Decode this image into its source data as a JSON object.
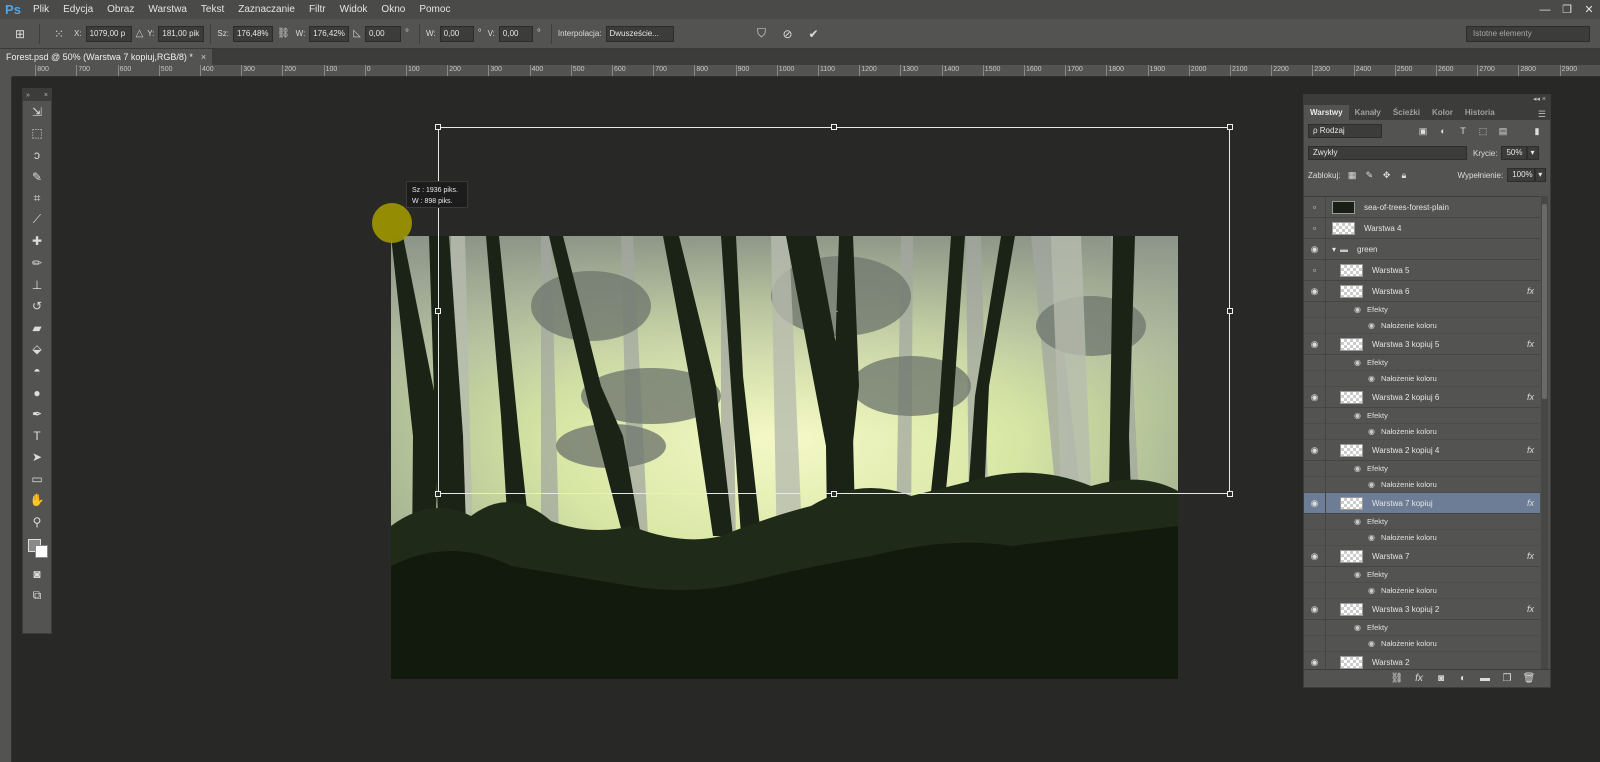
{
  "app": {
    "logo": "Ps"
  },
  "menu": [
    "Plik",
    "Edycja",
    "Obraz",
    "Warstwa",
    "Tekst",
    "Zaznaczanie",
    "Filtr",
    "Widok",
    "Okno",
    "Pomoc"
  ],
  "window_controls": {
    "minimize": "—",
    "maximize": "❐",
    "close": "✕"
  },
  "options": {
    "x_label": "X:",
    "x_value": "1079,00 p",
    "y_label": "Y:",
    "y_value": "181,00 pik",
    "w_label": "Sz:",
    "w_value": "176,48%",
    "h_label": "W:",
    "h_value": "176,42%",
    "angle_value": "0,00",
    "angle_unit": "°",
    "hskew_label": "W:",
    "hskew_value": "0,00",
    "hskew_unit": "°",
    "vskew_label": "V:",
    "vskew_value": "0,00",
    "vskew_unit": "°",
    "interp_label": "Interpolacja:",
    "interp_value": "Dwuszeście...",
    "workspace": "Istotne elementy"
  },
  "document_tab": {
    "title": "Forest.psd @ 50% (Warstwa 7 kopiuj,RGB/8) *",
    "close": "×"
  },
  "ruler_labels": [
    "900",
    "800",
    "700",
    "600",
    "500",
    "400",
    "300",
    "200",
    "100",
    "0",
    "100",
    "200",
    "300",
    "400",
    "500",
    "600",
    "700",
    "800",
    "900",
    "1000",
    "1100",
    "1200",
    "1300",
    "1400",
    "1500",
    "1600",
    "1700",
    "1800",
    "1900",
    "2000",
    "2100",
    "2200",
    "2300",
    "2400",
    "2500",
    "2600",
    "2700",
    "2800",
    "2900"
  ],
  "tooltip": {
    "line1": "Sz :  1936 piks.",
    "line2": "W :    898 piks."
  },
  "tools": [
    "move-icon",
    "marquee-icon",
    "lasso-icon",
    "quick-select-icon",
    "crop-icon",
    "eyedropper-icon",
    "healing-icon",
    "brush-icon",
    "stamp-icon",
    "history-brush-icon",
    "eraser-icon",
    "bucket-icon",
    "blur-icon",
    "dodge-icon",
    "pen-icon",
    "type-icon",
    "path-select-icon",
    "rectangle-icon",
    "hand-icon",
    "zoom-icon"
  ],
  "tool_glyphs": [
    "⇲",
    "⬚",
    "ↄ",
    "✎",
    "⌗",
    "⟋",
    "✚",
    "✏",
    "⊥",
    "↺",
    "▰",
    "⬙",
    "◓",
    "●",
    "✒",
    "T",
    "➤",
    "▭",
    "✋",
    "⚲"
  ],
  "layers_panel": {
    "tabs": [
      "Warstwy",
      "Kanały",
      "Ścieżki",
      "Kolor",
      "Historia"
    ],
    "kind_filter": "ρ Rodzaj",
    "blend_mode": "Zwykły",
    "opacity_label": "Krycie:",
    "opacity_value": "50%",
    "lock_label": "Zablokuj:",
    "fill_label": "Wypełnienie:",
    "fill_value": "100%",
    "effects_label": "Efekty",
    "effect_name": "Nałożenie koloru",
    "layers": [
      {
        "name": "sea-of-trees-forest-plain",
        "visible": false
      },
      {
        "name": "Warstwa 4",
        "visible": false
      },
      {
        "name": "green",
        "visible": true,
        "group": true
      },
      {
        "name": "Warstwa 5",
        "visible": false
      },
      {
        "name": "Warstwa 6",
        "visible": true,
        "fx": true
      },
      {
        "name": "Warstwa 3 kopiuj 5",
        "visible": true,
        "fx": true
      },
      {
        "name": "Warstwa 2 kopiuj 6",
        "visible": true,
        "fx": true
      },
      {
        "name": "Warstwa 2 kopiuj 4",
        "visible": true,
        "fx": true
      },
      {
        "name": "Warstwa 7 kopiuj",
        "visible": true,
        "fx": true,
        "selected": true
      },
      {
        "name": "Warstwa 7",
        "visible": true,
        "fx": true
      },
      {
        "name": "Warstwa 3 kopiuj 2",
        "visible": true,
        "fx": true
      },
      {
        "name": "Warstwa 2",
        "visible": true
      }
    ],
    "fx_label": "fx"
  }
}
